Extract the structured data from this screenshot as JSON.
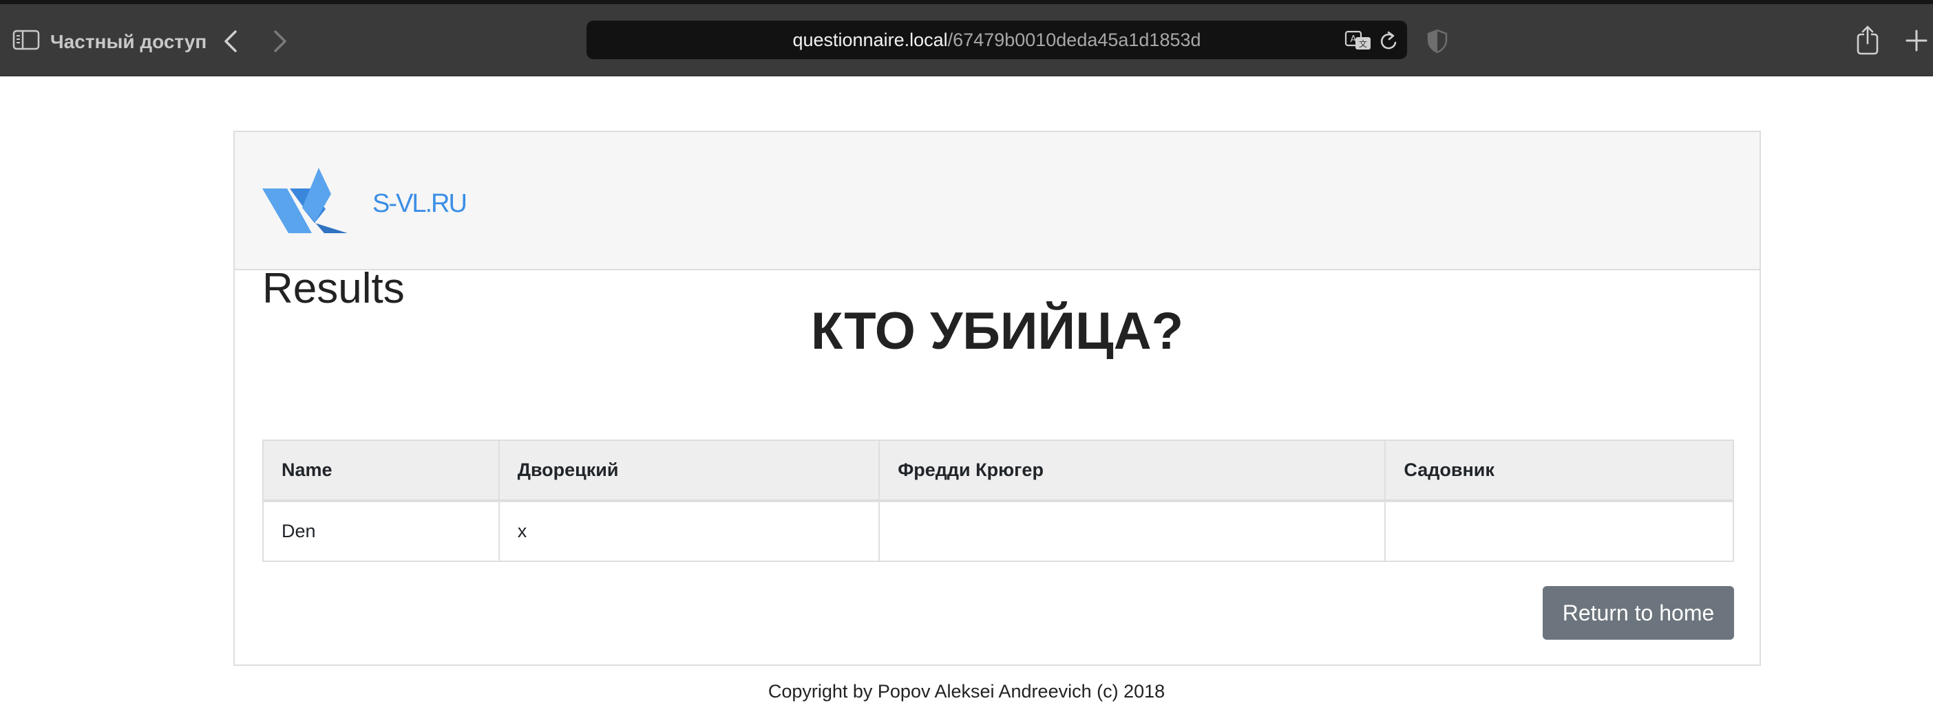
{
  "browser": {
    "private_label": "Частный доступ",
    "address_host": "questionnaire.local",
    "address_path": "/67479b0010deda45a1d1853d",
    "icons": {
      "sidebar": "sidebar-icon",
      "back": "chevron-left-icon",
      "forward": "chevron-right-icon",
      "translate": "translate-icon",
      "reload": "reload-icon",
      "privacy": "shield-icon",
      "share": "share-icon",
      "new_tab": "plus-icon"
    }
  },
  "header": {
    "logo_text": "S-VL.RU",
    "logo_color": "#3b8ee6"
  },
  "main": {
    "title": "КТО УБИЙЦА?",
    "results_heading": "Results",
    "table": {
      "columns": [
        "Name",
        "Дворецкий",
        "Фредди Крюгер",
        "Садовник"
      ],
      "rows": [
        [
          "Den",
          "x",
          "",
          ""
        ]
      ]
    },
    "return_button_label": "Return to home",
    "button_color": "#6c757d"
  },
  "footer": {
    "copyright": "Copyright by Popov Aleksei Andreevich (c) 2018"
  }
}
